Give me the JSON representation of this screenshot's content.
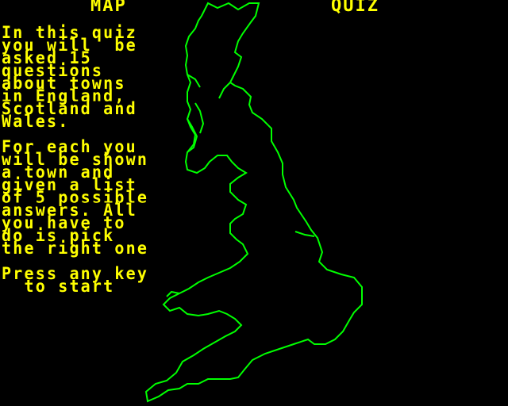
{
  "screen": {
    "title_left": "MAP",
    "title_right": "QUIZ",
    "intro_lines": [
      "In this quiz",
      "you will  be",
      "asked 15",
      "questions",
      "about towns",
      "in England,",
      "Scotland and",
      "Wales."
    ],
    "instruction_lines": [
      "For each you",
      "will be shown",
      "a town and",
      "given a list",
      "of 5 possible",
      "answers. All",
      "you have to",
      "do is pick",
      "the right one"
    ],
    "prompt_lines": [
      "Press any key",
      "  to start"
    ]
  },
  "colors": {
    "background": "#000000",
    "text": "#ffff00",
    "map_outline": "#00ff00"
  }
}
